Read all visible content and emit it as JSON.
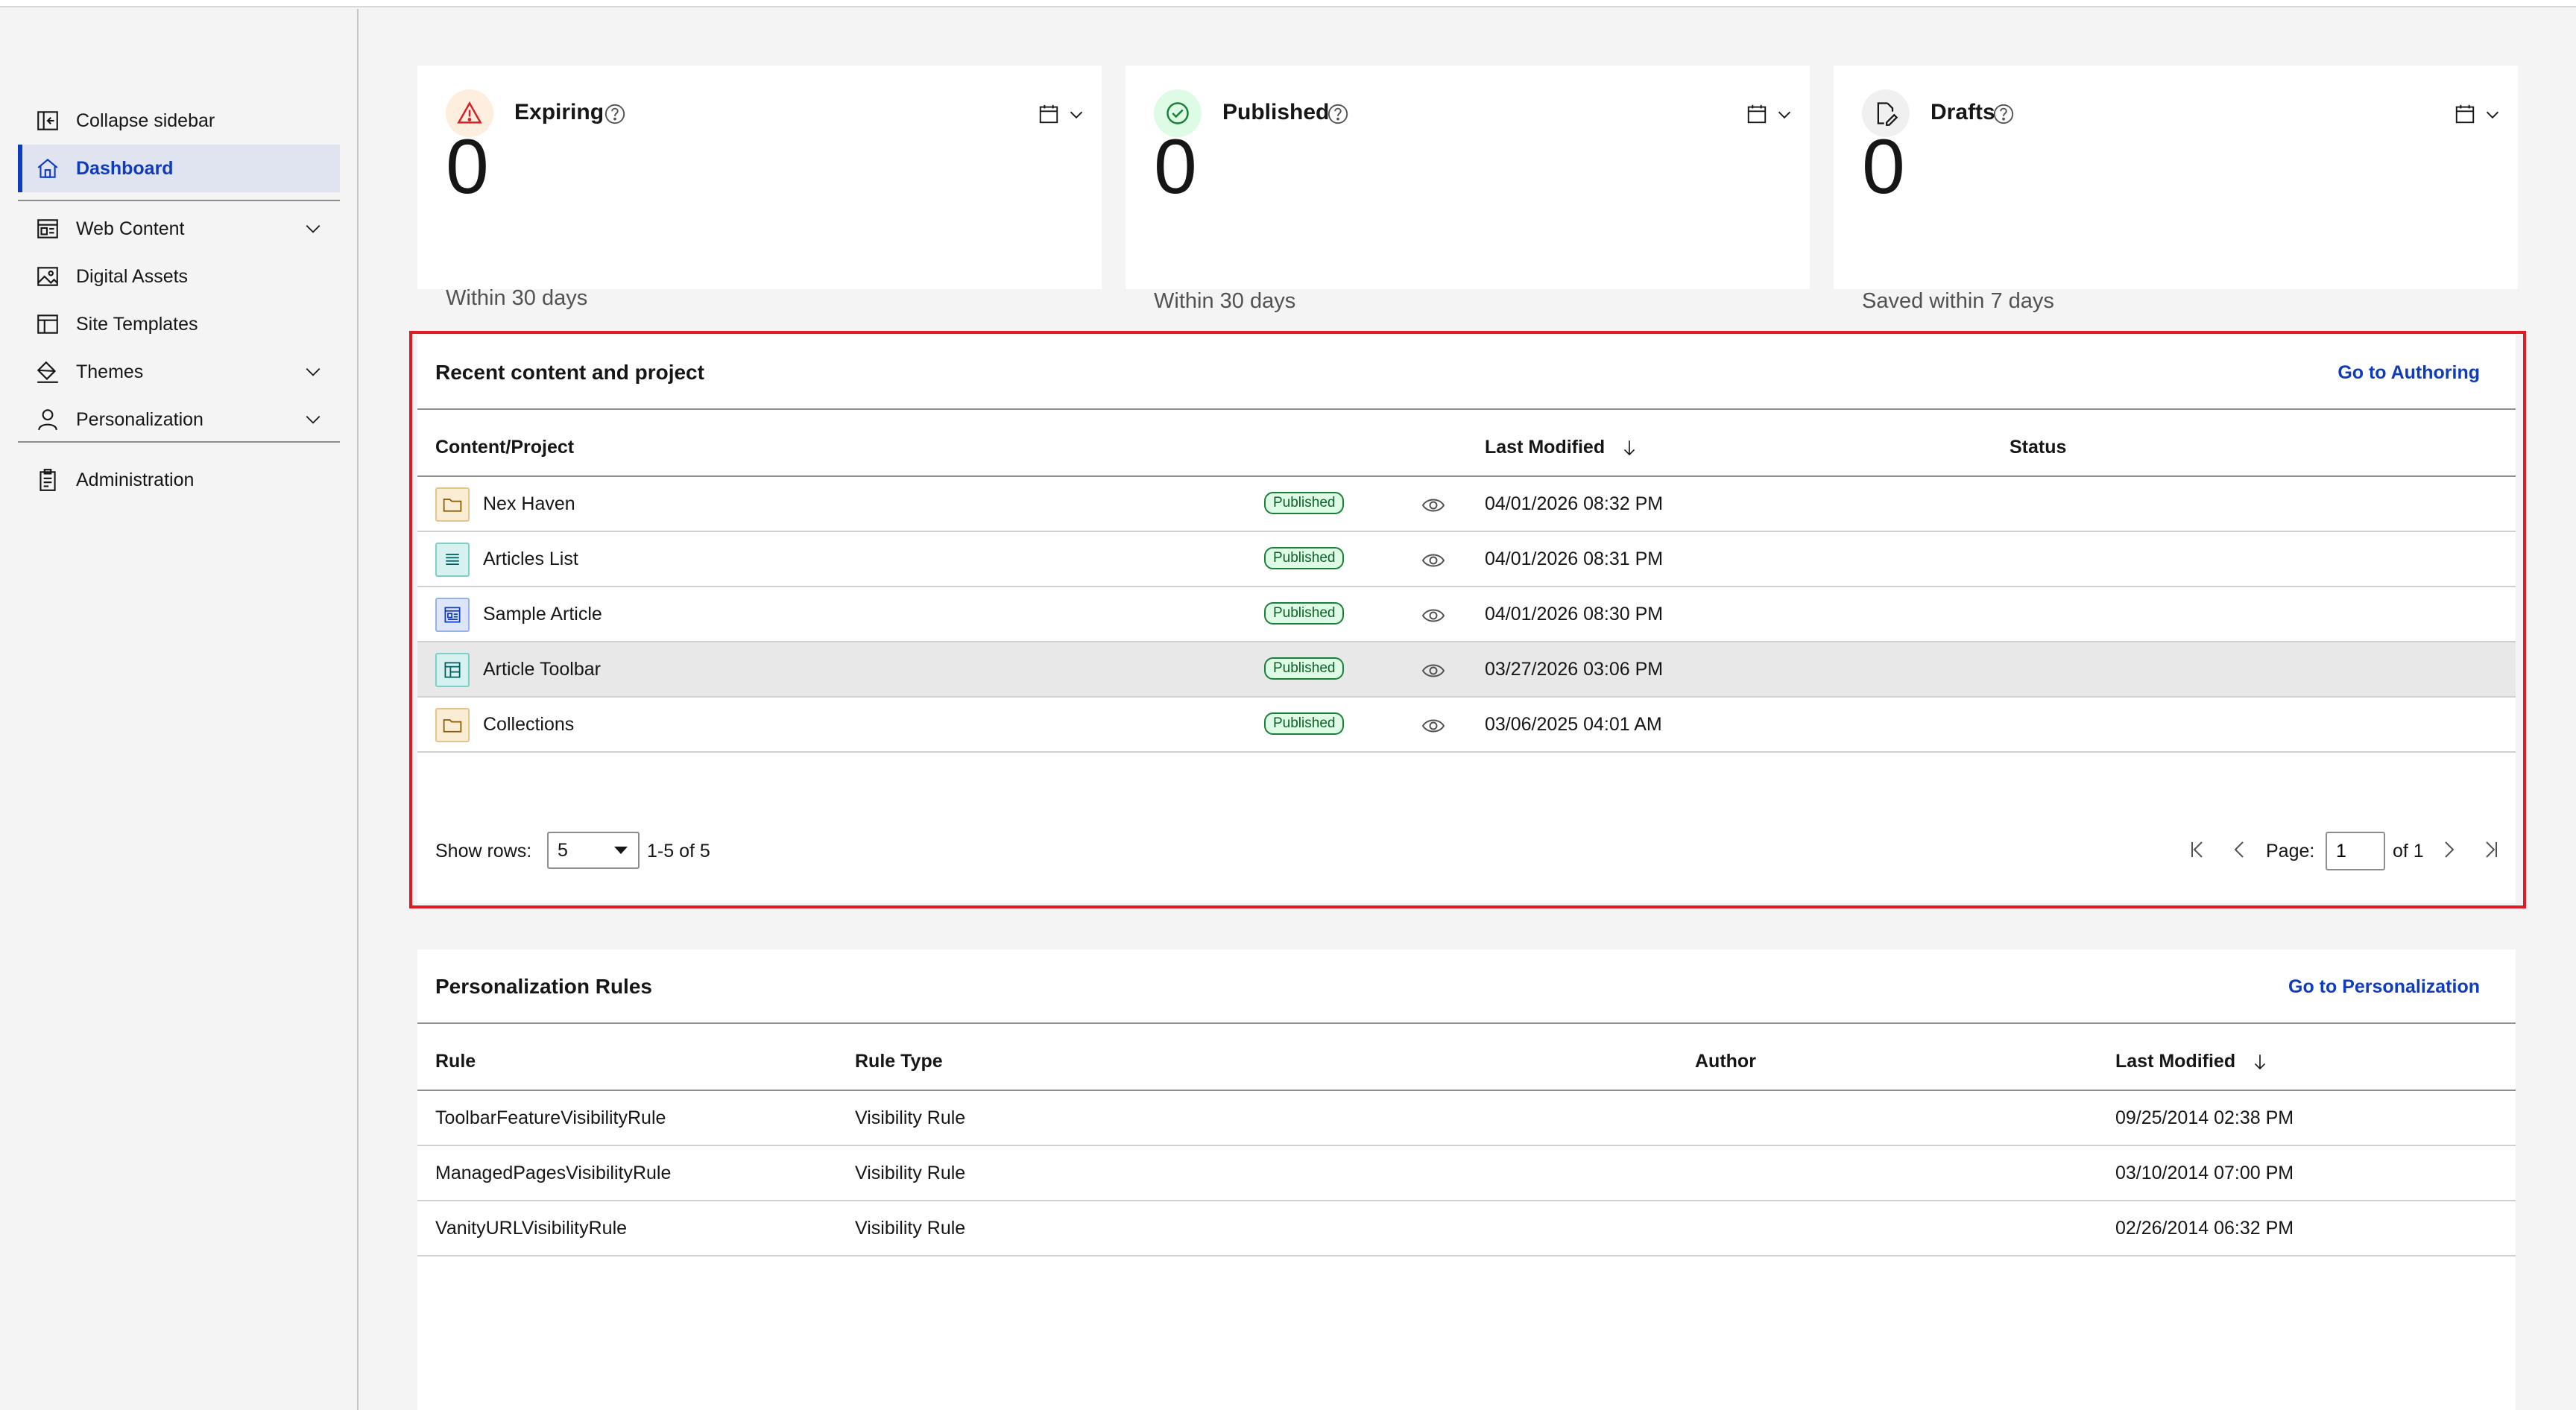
{
  "sidebar": {
    "collapse_label": "Collapse sidebar",
    "items": [
      {
        "label": "Dashboard",
        "icon": "home-icon"
      },
      {
        "label": "Web Content",
        "icon": "web-content-icon"
      },
      {
        "label": "Digital Assets",
        "icon": "image-icon"
      },
      {
        "label": "Site Templates",
        "icon": "template-icon"
      },
      {
        "label": "Themes",
        "icon": "paint-bucket-icon"
      },
      {
        "label": "Personalization",
        "icon": "user-icon"
      },
      {
        "label": "Administration",
        "icon": "clipboard-icon"
      }
    ]
  },
  "cards": [
    {
      "title": "Expiring",
      "value": "0",
      "subtitle": "Within 30 days",
      "icon": "warning-icon",
      "color": "#da1e28"
    },
    {
      "title": "Published",
      "value": "0",
      "subtitle": "Within 30 days",
      "icon": "checkmark-icon",
      "color": "#24a148"
    },
    {
      "title": "Drafts",
      "value": "0",
      "subtitle": "Saved within 7 days",
      "icon": "draft-icon",
      "color": "#393939"
    }
  ],
  "recent": {
    "title": "Recent content and project",
    "link": "Go to Authoring",
    "columns": {
      "content": "Content/Project",
      "modified": "Last Modified",
      "status": "Status"
    },
    "rows": [
      {
        "name": "Nex Haven",
        "modified": "04/01/2026 08:32 PM",
        "status": "Published",
        "type": "folder-icon"
      },
      {
        "name": "Articles List",
        "modified": "04/01/2026 08:31 PM",
        "status": "Published",
        "type": "list-icon"
      },
      {
        "name": "Sample Article",
        "modified": "04/01/2026 08:30 PM",
        "status": "Published",
        "type": "article-icon"
      },
      {
        "name": "Article Toolbar",
        "modified": "03/27/2026 03:06 PM",
        "status": "Published",
        "type": "layout-icon"
      },
      {
        "name": "Collections",
        "modified": "03/06/2025 04:01 AM",
        "status": "Published",
        "type": "folder-icon"
      }
    ],
    "pager": {
      "show_rows_label": "Show rows:",
      "rows_value": "5",
      "range": "1-5 of 5",
      "page_label": "Page:",
      "page_value": "1",
      "of_label": "of 1"
    }
  },
  "rules": {
    "title": "Personalization Rules",
    "link": "Go to Personalization",
    "columns": {
      "rule": "Rule",
      "type": "Rule Type",
      "author": "Author",
      "modified": "Last Modified"
    },
    "rows": [
      {
        "rule": "ToolbarFeatureVisibilityRule",
        "type": "Visibility Rule",
        "author": "",
        "modified": "09/25/2014 02:38 PM"
      },
      {
        "rule": "ManagedPagesVisibilityRule",
        "type": "Visibility Rule",
        "author": "",
        "modified": "03/10/2014 07:00 PM"
      },
      {
        "rule": "VanityURLVisibilityRule",
        "type": "Visibility Rule",
        "author": "",
        "modified": "02/26/2014 06:32 PM"
      }
    ]
  },
  "colors": {
    "accent": "#0f3bbf",
    "highlight": "#e01b24",
    "success": "#198038"
  }
}
